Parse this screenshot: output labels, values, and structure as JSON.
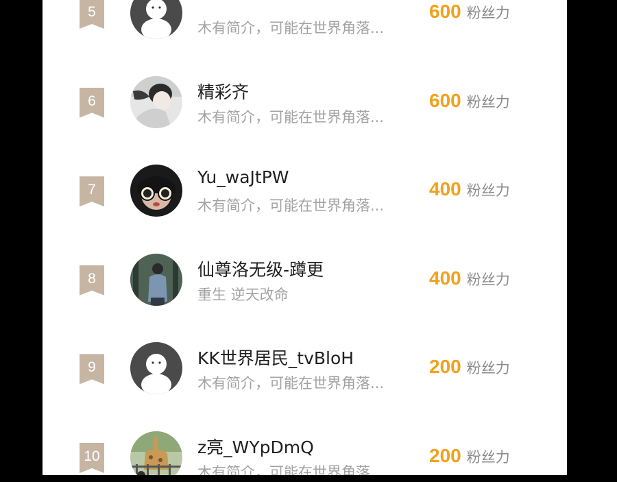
{
  "fans_list": {
    "fans_unit": "粉丝力",
    "rows": [
      {
        "rank": "5",
        "name": "",
        "bio": "木有简介，可能在世界角落...",
        "fans": "600",
        "avatar_icon": "default-ghost-avatar-icon"
      },
      {
        "rank": "6",
        "name": "精彩齐",
        "bio": "木有简介，可能在世界角落...",
        "fans": "600",
        "avatar_icon": "user-photo-avatar-icon"
      },
      {
        "rank": "7",
        "name": "Yu_waJtPW",
        "bio": "木有简介，可能在世界角落...",
        "fans": "400",
        "avatar_icon": "sunglasses-avatar-icon"
      },
      {
        "rank": "8",
        "name": "仙尊洛无级-蹲更",
        "bio": "重生 逆天改命",
        "fans": "400",
        "avatar_icon": "person-photo-avatar-icon"
      },
      {
        "rank": "9",
        "name": "KK世界居民_tvBloH",
        "bio": "木有简介，可能在世界角落...",
        "fans": "200",
        "avatar_icon": "default-ghost-avatar-icon"
      },
      {
        "rank": "10",
        "name": "z亮_WYpDmQ",
        "bio": "木有简介，可能在世界角落...",
        "fans": "200",
        "avatar_icon": "zoo-photo-avatar-icon"
      }
    ]
  },
  "colors": {
    "rank_badge": "#c7b5a3",
    "fans_count": "#f0a21e",
    "name_text": "#1f1f1f",
    "bio_text": "#a3a3a3",
    "frame": "#000000"
  }
}
